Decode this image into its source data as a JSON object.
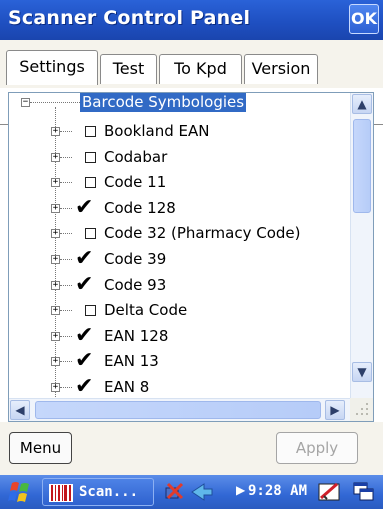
{
  "window": {
    "title": "Scanner Control Panel",
    "ok_label": "OK"
  },
  "tabs": [
    {
      "label": "Settings",
      "active": true
    },
    {
      "label": "Test",
      "active": false
    },
    {
      "label": "To Kpd",
      "active": false
    },
    {
      "label": "Version",
      "active": false
    }
  ],
  "tree": {
    "root": {
      "label": "Barcode Symbologies",
      "expander": "−"
    },
    "items": [
      {
        "label": "Bookland EAN",
        "checked": false
      },
      {
        "label": "Codabar",
        "checked": false
      },
      {
        "label": "Code 11",
        "checked": false
      },
      {
        "label": "Code 128",
        "checked": true
      },
      {
        "label": "Code 32 (Pharmacy Code)",
        "checked": false
      },
      {
        "label": "Code 39",
        "checked": true
      },
      {
        "label": "Code 93",
        "checked": true
      },
      {
        "label": "Delta Code",
        "checked": false
      },
      {
        "label": "EAN 128",
        "checked": true
      },
      {
        "label": "EAN 13",
        "checked": true
      },
      {
        "label": "EAN 8",
        "checked": true
      }
    ]
  },
  "buttons": {
    "menu": "Menu",
    "apply": "Apply"
  },
  "taskbar": {
    "task_label": "Scan...",
    "time": "9:28 AM"
  },
  "colors": {
    "titlebar": "#2a62d8",
    "selection": "#316ac5",
    "taskbar": "#3167d4"
  }
}
